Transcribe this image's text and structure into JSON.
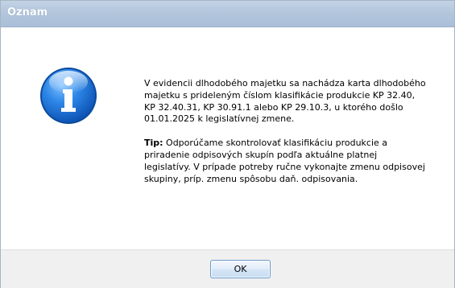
{
  "window": {
    "title": "Oznam"
  },
  "icon": {
    "name": "info-icon",
    "color": "#1f6fd1"
  },
  "message": {
    "paragraph1": "V evidencii dlhodobého majetku sa nachádza karta dlhodobého majetku s prideleným číslom klasifikácie produkcie KP 32.40, KP 32.40.31, KP 30.91.1 alebo KP 29.10.3, u ktorého došlo 01.01.2025 k legislatívnej zmene.",
    "tip_label": "Tip:",
    "tip_text": " Odporúčame skontrolovať klasifikáciu produkcie a priradenie odpisových skupín podľa aktuálne platnej legislatívy. V prípade potreby ručne vykonajte zmenu odpisovej skupiny, príp. zmenu spôsobu daň. odpisovania."
  },
  "buttons": {
    "ok_label": "OK"
  }
}
